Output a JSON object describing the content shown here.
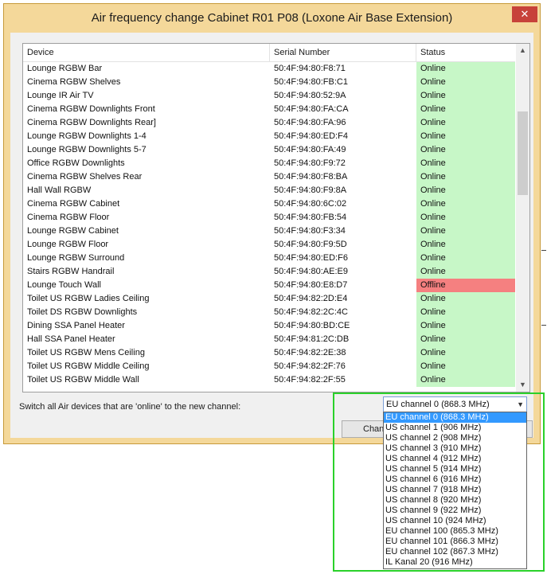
{
  "window": {
    "title": "Air frequency change Cabinet R01 P08 (Loxone Air Base Extension)",
    "close_glyph": "✕"
  },
  "table": {
    "headers": {
      "device": "Device",
      "serial": "Serial Number",
      "status": "Status"
    },
    "rows": [
      {
        "device": "Lounge RGBW Bar",
        "serial": "50:4F:94:80:F8:71",
        "status": "Online"
      },
      {
        "device": "Cinema RGBW Shelves",
        "serial": "50:4F:94:80:FB:C1",
        "status": "Online"
      },
      {
        "device": "Lounge IR Air TV",
        "serial": "50:4F:94:80:52:9A",
        "status": "Online"
      },
      {
        "device": "Cinema RGBW Downlights Front",
        "serial": "50:4F:94:80:FA:CA",
        "status": "Online"
      },
      {
        "device": "Cinema RGBW Downlights Rear]",
        "serial": "50:4F:94:80:FA:96",
        "status": "Online"
      },
      {
        "device": "Lounge RGBW Downlights 1-4",
        "serial": "50:4F:94:80:ED:F4",
        "status": "Online"
      },
      {
        "device": "Lounge RGBW Downlights 5-7",
        "serial": "50:4F:94:80:FA:49",
        "status": "Online"
      },
      {
        "device": "Office RGBW Downlights",
        "serial": "50:4F:94:80:F9:72",
        "status": "Online"
      },
      {
        "device": "Cinema RGBW Shelves Rear",
        "serial": "50:4F:94:80:F8:BA",
        "status": "Online"
      },
      {
        "device": "Hall Wall RGBW",
        "serial": "50:4F:94:80:F9:8A",
        "status": "Online"
      },
      {
        "device": "Cinema RGBW Cabinet",
        "serial": "50:4F:94:80:6C:02",
        "status": "Online"
      },
      {
        "device": "Cinema RGBW Floor",
        "serial": "50:4F:94:80:FB:54",
        "status": "Online"
      },
      {
        "device": "Lounge RGBW Cabinet",
        "serial": "50:4F:94:80:F3:34",
        "status": "Online"
      },
      {
        "device": "Lounge RGBW Floor",
        "serial": "50:4F:94:80:F9:5D",
        "status": "Online"
      },
      {
        "device": "Lounge RGBW Surround",
        "serial": "50:4F:94:80:ED:F6",
        "status": "Online"
      },
      {
        "device": "Stairs RGBW Handrail",
        "serial": "50:4F:94:80:AE:E9",
        "status": "Online"
      },
      {
        "device": "Lounge Touch Wall",
        "serial": "50:4F:94:80:E8:D7",
        "status": "Offline"
      },
      {
        "device": "Toilet US RGBW Ladies Ceiling",
        "serial": "50:4F:94:82:2D:E4",
        "status": "Online"
      },
      {
        "device": "Toilet DS RGBW Downlights",
        "serial": "50:4F:94:82:2C:4C",
        "status": "Online"
      },
      {
        "device": "Dining SSA Panel Heater",
        "serial": "50:4F:94:80:BD:CE",
        "status": "Online"
      },
      {
        "device": "Hall SSA Panel Heater",
        "serial": "50:4F:94:81:2C:DB",
        "status": "Online"
      },
      {
        "device": "Toilet US RGBW Mens Ceiling",
        "serial": "50:4F:94:82:2E:38",
        "status": "Online"
      },
      {
        "device": "Toilet US RGBW Middle Ceiling",
        "serial": "50:4F:94:82:2F:76",
        "status": "Online"
      },
      {
        "device": "Toilet US RGBW Middle Wall",
        "serial": "50:4F:94:82:2F:55",
        "status": "Online"
      }
    ]
  },
  "switch_label": "Switch all Air devices that are 'online' to the new channel:",
  "change_button_label": "Chang",
  "channel": {
    "selected": "EU channel 0 (868.3 MHz)",
    "options": [
      "EU channel 0 (868.3 MHz)",
      "US channel 1 (906 MHz)",
      "US channel 2 (908 MHz)",
      "US channel 3 (910 MHz)",
      "US channel 4 (912 MHz)",
      "US channel 5 (914 MHz)",
      "US channel 6 (916 MHz)",
      "US channel 7 (918 MHz)",
      "US channel 8 (920 MHz)",
      "US channel 9 (922 MHz)",
      "US channel 10 (924 MHz)",
      "EU channel 100 (865.3 MHz)",
      "EU channel 101 (866.3 MHz)",
      "EU channel 102 (867.3 MHz)",
      "IL Kanal 20 (916 MHz)"
    ]
  },
  "colors": {
    "online": "#c7f7c7",
    "offline": "#f58080",
    "highlight": "#2ad12a",
    "selection": "#3399ff"
  },
  "icons": {
    "close": "close-icon",
    "scroll_up": "chevron-up-icon",
    "scroll_down": "chevron-down-icon",
    "combo": "chevron-down-icon"
  }
}
